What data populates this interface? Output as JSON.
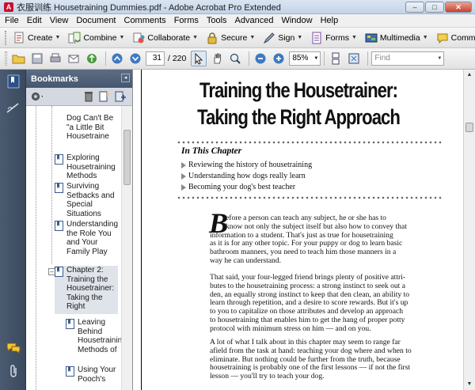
{
  "window": {
    "title": "衣服训练 Housetraining Dummies.pdf - Adobe Acrobat Pro Extended",
    "icon_label": "A",
    "minimize": "–",
    "maximize": "□",
    "close": "✕"
  },
  "menu": [
    "File",
    "Edit",
    "View",
    "Document",
    "Comments",
    "Forms",
    "Tools",
    "Advanced",
    "Window",
    "Help"
  ],
  "toolbar_tasks": [
    {
      "label": "Create",
      "icon": "create-icon"
    },
    {
      "label": "Combine",
      "icon": "combine-icon"
    },
    {
      "label": "Collaborate",
      "icon": "collaborate-icon"
    },
    {
      "label": "Secure",
      "icon": "lock-icon"
    },
    {
      "label": "Sign",
      "icon": "pen-icon"
    },
    {
      "label": "Forms",
      "icon": "forms-icon"
    },
    {
      "label": "Multimedia",
      "icon": "multimedia-icon"
    },
    {
      "label": "Comment",
      "icon": "comment-icon"
    }
  ],
  "nav": {
    "current_page": "31",
    "total_pages": "/ 220",
    "zoom": "85%",
    "find_placeholder": "Find"
  },
  "bookmarks": {
    "title": "Bookmarks",
    "collapse": "◂",
    "items": [
      {
        "text": "Dog Can't Be \"a Little Bit Housetraine"
      },
      {
        "text": "Exploring Housetraining Methods"
      },
      {
        "text": "Surviving Setbacks and Special Situations"
      },
      {
        "text": "Understanding the Role You and Your Family Play"
      },
      {
        "text": "Chapter 2: Training the Housetrainer: Taking the Right"
      },
      {
        "text": "Leaving Behind Housetraining Methods of"
      },
      {
        "text": "Using Your Pooch's"
      }
    ]
  },
  "document": {
    "title_line1": "Training the Housetrainer:",
    "title_line2": "Taking the Right Approach",
    "in_this_chapter": "In This Chapter",
    "bullets": [
      "Reviewing the history of housetraining",
      "Understanding how dogs really learn",
      "Becoming your dog's best teacher"
    ],
    "dropcap": "B",
    "para1": [
      "efore a person can teach any subject, he or she has to",
      "know not only the subject itself but also how to convey that",
      "information to a student. That's just as true for housetraining",
      "as it is for any other topic. For your puppy or dog to learn basic",
      "bathroom manners, you need to teach him those manners in a",
      "way he can understand."
    ],
    "para2": [
      "That said, your four-legged friend brings plenty of positive attri-",
      "butes to the housetraining process: a strong instinct to seek out a",
      "den, an equally strong instinct to keep that den clean, an ability to",
      "learn through repetition, and a desire to score rewards. But it's up",
      "to you to capitalize on those attributes and develop an approach",
      "to housetraining that enables him to get the hang of proper potty",
      "protocol with minimum stress on him — and on you."
    ],
    "para3": [
      "A lot of what I talk about in this chapter may seem to range far",
      "afield from the task at hand: teaching your dog where and when to",
      "eliminate. But nothing could be further from the truth, because",
      "housetraining is probably one of the first lessons — if not the first",
      "lesson — you'll try to teach your dog."
    ]
  }
}
